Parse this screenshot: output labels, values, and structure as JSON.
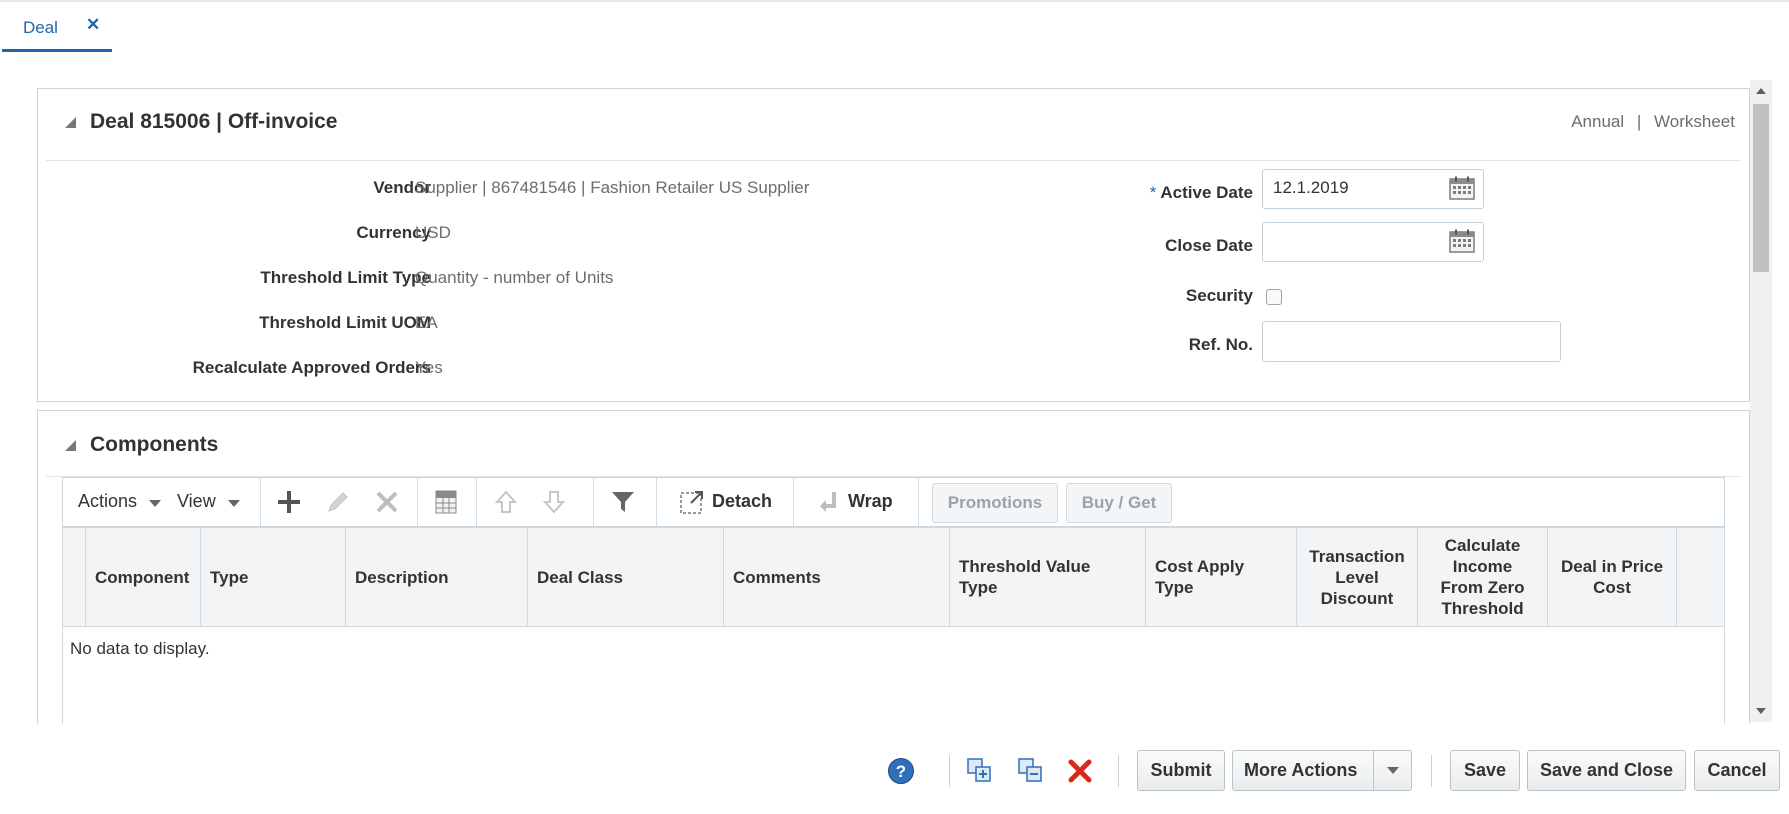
{
  "tabs": [
    {
      "label": "Deal",
      "close": "✕"
    }
  ],
  "header": {
    "title": "Deal 815006  |  Off-invoice",
    "link_annual": "Annual",
    "link_sep": "|",
    "link_worksheet": "Worksheet"
  },
  "details": {
    "vendor_label": "Vendor",
    "vendor_value": "Supplier  |  867481546  |  Fashion Retailer US Supplier",
    "currency_label": "Currency",
    "currency_value": "USD",
    "threshold_type_label": "Threshold Limit Type",
    "threshold_type_value": "Quantity - number of Units",
    "threshold_uom_label": "Threshold Limit UOM",
    "threshold_uom_value": "EA",
    "recalc_label": "Recalculate Approved Orders",
    "recalc_value": "Yes",
    "required_marker": "*",
    "active_date_label": "Active Date",
    "active_date_value": "12.1.2019",
    "close_date_label": "Close Date",
    "close_date_value": "",
    "security_label": "Security",
    "security_checked": false,
    "ref_no_label": "Ref. No.",
    "ref_no_value": ""
  },
  "components": {
    "title": "Components",
    "toolbar": {
      "actions": "Actions",
      "view": "View",
      "detach": "Detach",
      "wrap": "Wrap",
      "promotions": "Promotions",
      "buy_get": "Buy / Get"
    },
    "columns": [
      "Component",
      "Type",
      "Description",
      "Deal Class",
      "Comments",
      "Threshold Value Type",
      "Cost Apply Type",
      "Transaction Level Discount",
      "Calculate Income From Zero Threshold",
      "Deal in Price Cost"
    ],
    "empty_message": "No data to display."
  },
  "footer": {
    "help": "?",
    "submit": "Submit",
    "more_actions": "More Actions",
    "save": "Save",
    "save_and_close": "Save and Close",
    "cancel": "Cancel"
  },
  "colors": {
    "accent": "#1f67a8",
    "delete_red": "#d9281c",
    "help_blue": "#2f6fb7"
  }
}
